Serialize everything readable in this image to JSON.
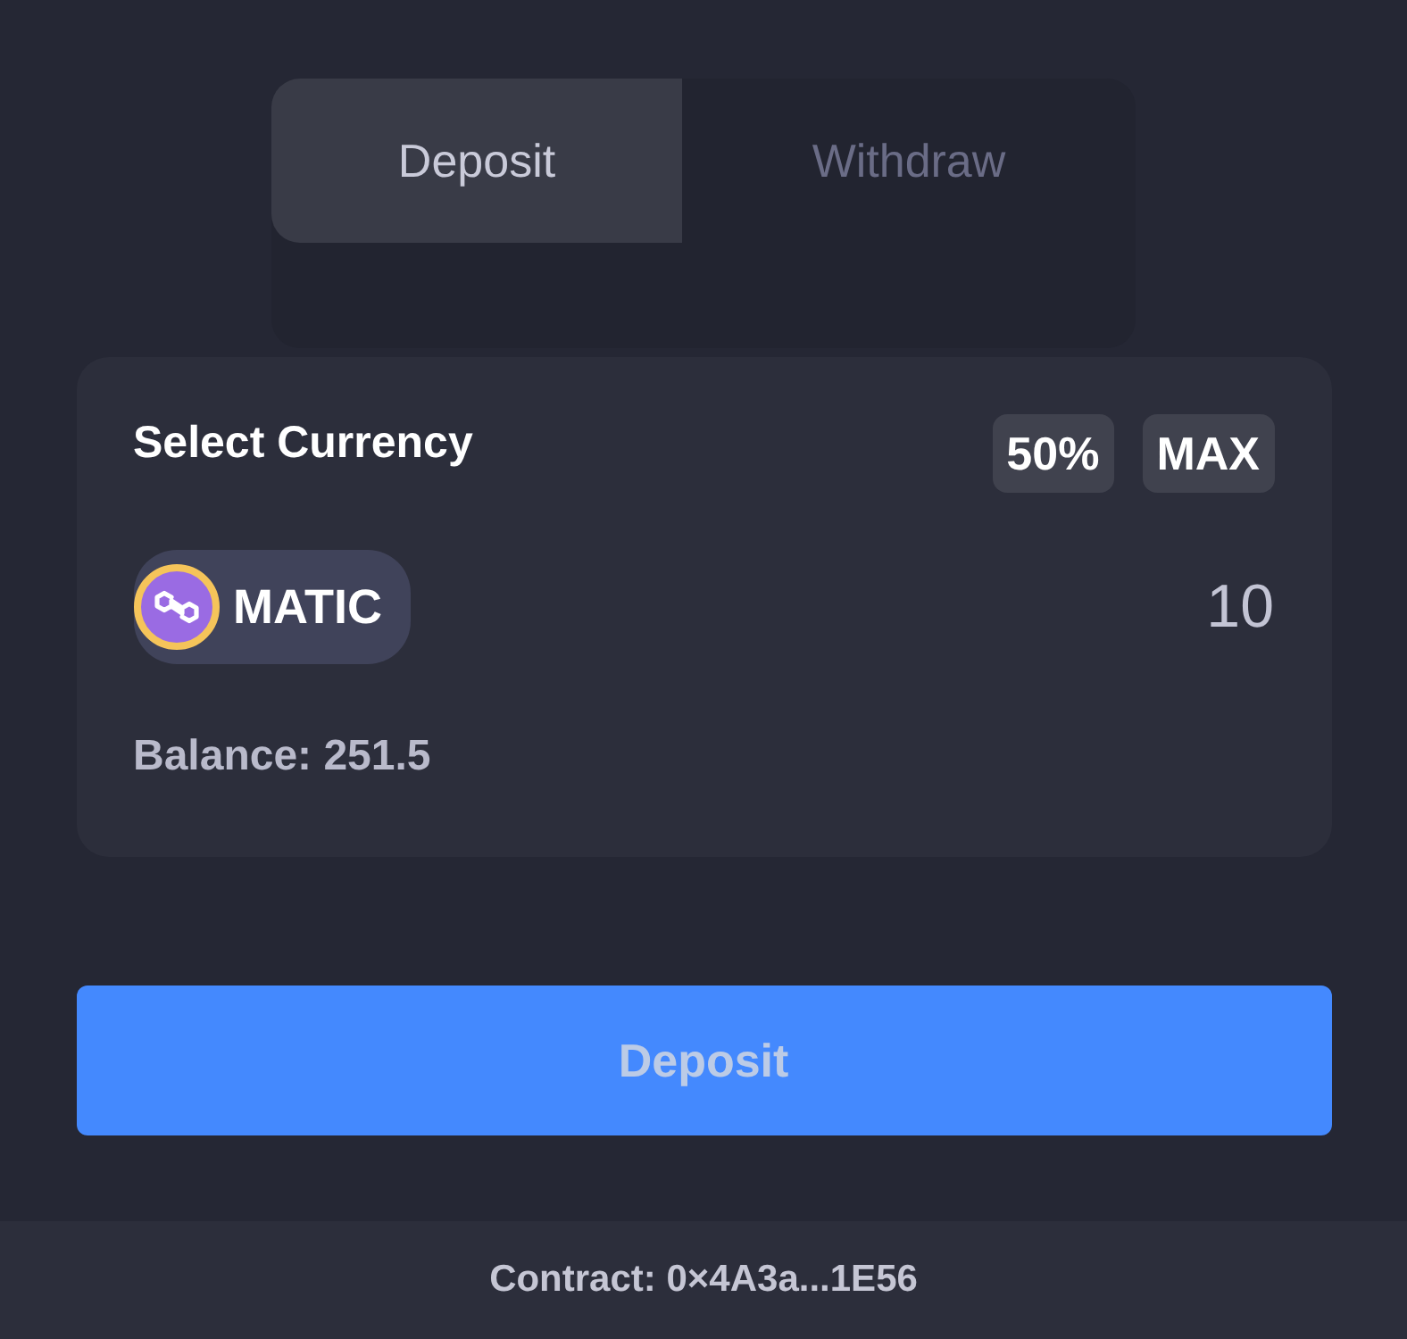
{
  "tabs": [
    {
      "label": "Deposit",
      "selected": true
    },
    {
      "label": "Withdraw",
      "selected": false
    }
  ],
  "card": {
    "title": "Select Currency",
    "quick_buttons": [
      "50%",
      "MAX"
    ],
    "currency": {
      "symbol": "MATIC"
    },
    "amount": {
      "value": "10"
    },
    "balance": "Balance: 251.5"
  },
  "submit_button": {
    "label": "Deposit"
  },
  "footer": {
    "text": "Contract: 0×4A3a...1E56"
  }
}
